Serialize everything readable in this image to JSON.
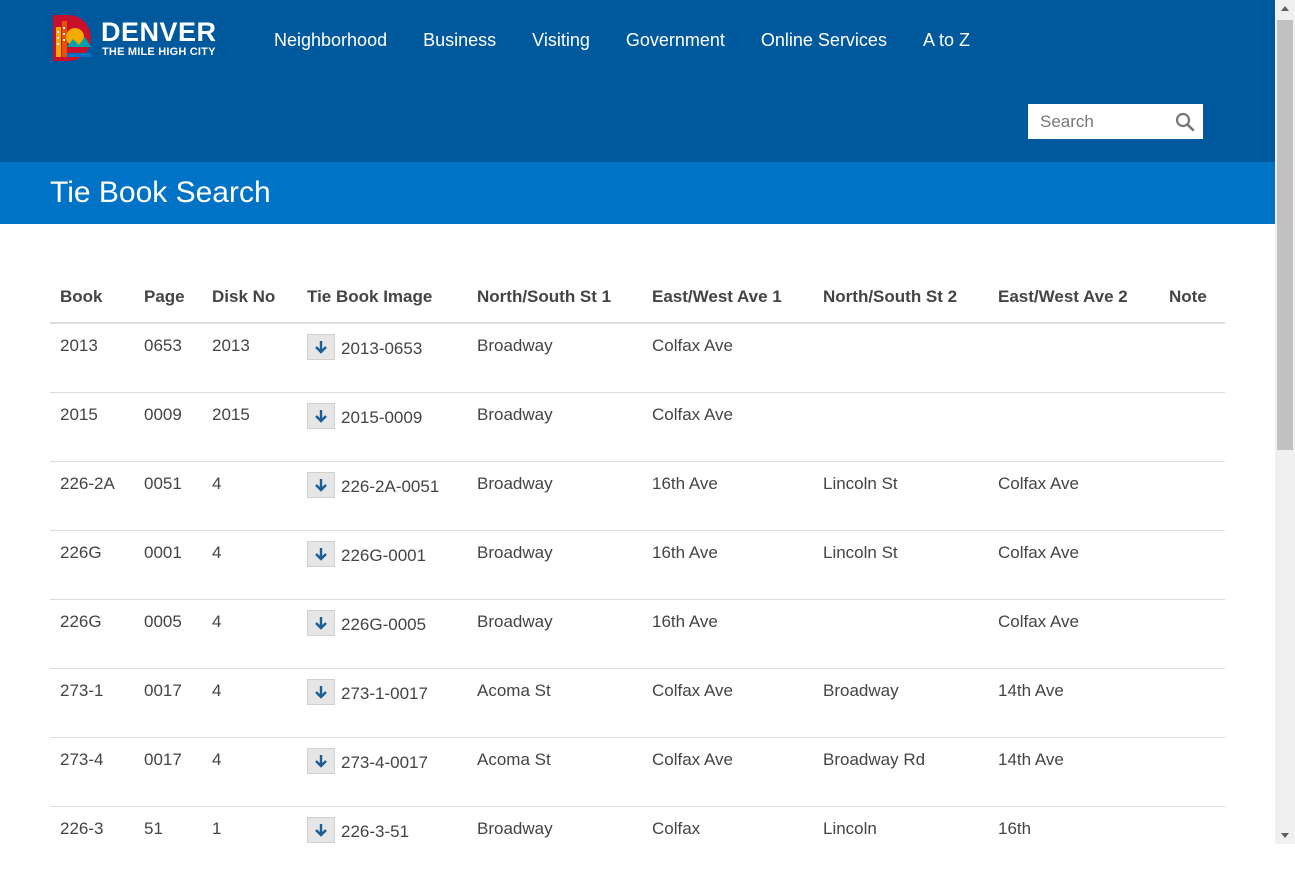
{
  "logo": {
    "wordmark": "DENVER",
    "tagline": "THE MILE HIGH CITY"
  },
  "nav": {
    "items": [
      {
        "label": "Neighborhood"
      },
      {
        "label": "Business"
      },
      {
        "label": "Visiting"
      },
      {
        "label": "Government"
      },
      {
        "label": "Online Services"
      },
      {
        "label": "A to Z"
      }
    ]
  },
  "search": {
    "placeholder": "Search",
    "value": ""
  },
  "page": {
    "title": "Tie Book Search"
  },
  "table": {
    "headers": [
      "Book",
      "Page",
      "Disk No",
      "Tie Book Image",
      "North/South St 1",
      "East/West Ave 1",
      "North/South St 2",
      "East/West Ave 2",
      "Note"
    ],
    "rows": [
      [
        "2013",
        "0653",
        "2013",
        "2013-0653",
        "Broadway",
        "Colfax Ave",
        "",
        "",
        ""
      ],
      [
        "2015",
        "0009",
        "2015",
        "2015-0009",
        "Broadway",
        "Colfax Ave",
        "",
        "",
        ""
      ],
      [
        "226-2A",
        "0051",
        "4",
        "226-2A-0051",
        "Broadway",
        "16th Ave",
        "Lincoln St",
        "Colfax Ave",
        ""
      ],
      [
        "226G",
        "0001",
        "4",
        "226G-0001",
        "Broadway",
        "16th Ave",
        "Lincoln St",
        "Colfax Ave",
        ""
      ],
      [
        "226G",
        "0005",
        "4",
        "226G-0005",
        "Broadway",
        "16th Ave",
        "",
        "Colfax Ave",
        ""
      ],
      [
        "273-1",
        "0017",
        "4",
        "273-1-0017",
        "Acoma St",
        "Colfax Ave",
        "Broadway",
        "14th Ave",
        ""
      ],
      [
        "273-4",
        "0017",
        "4",
        "273-4-0017",
        "Acoma St",
        "Colfax Ave",
        "Broadway Rd",
        "14th Ave",
        ""
      ],
      [
        "226-3",
        "51",
        "1",
        "226-3-51",
        "Broadway",
        "Colfax",
        "Lincoln",
        "16th",
        ""
      ]
    ]
  },
  "colors": {
    "header_bg": "#00599c",
    "title_bar_bg": "#0073c7",
    "download_arrow": "#1a5e96",
    "body_text": "#444444"
  },
  "icons": {
    "search": "search-icon",
    "download": "download-arrow-icon",
    "logo": "denver-logo-icon"
  }
}
